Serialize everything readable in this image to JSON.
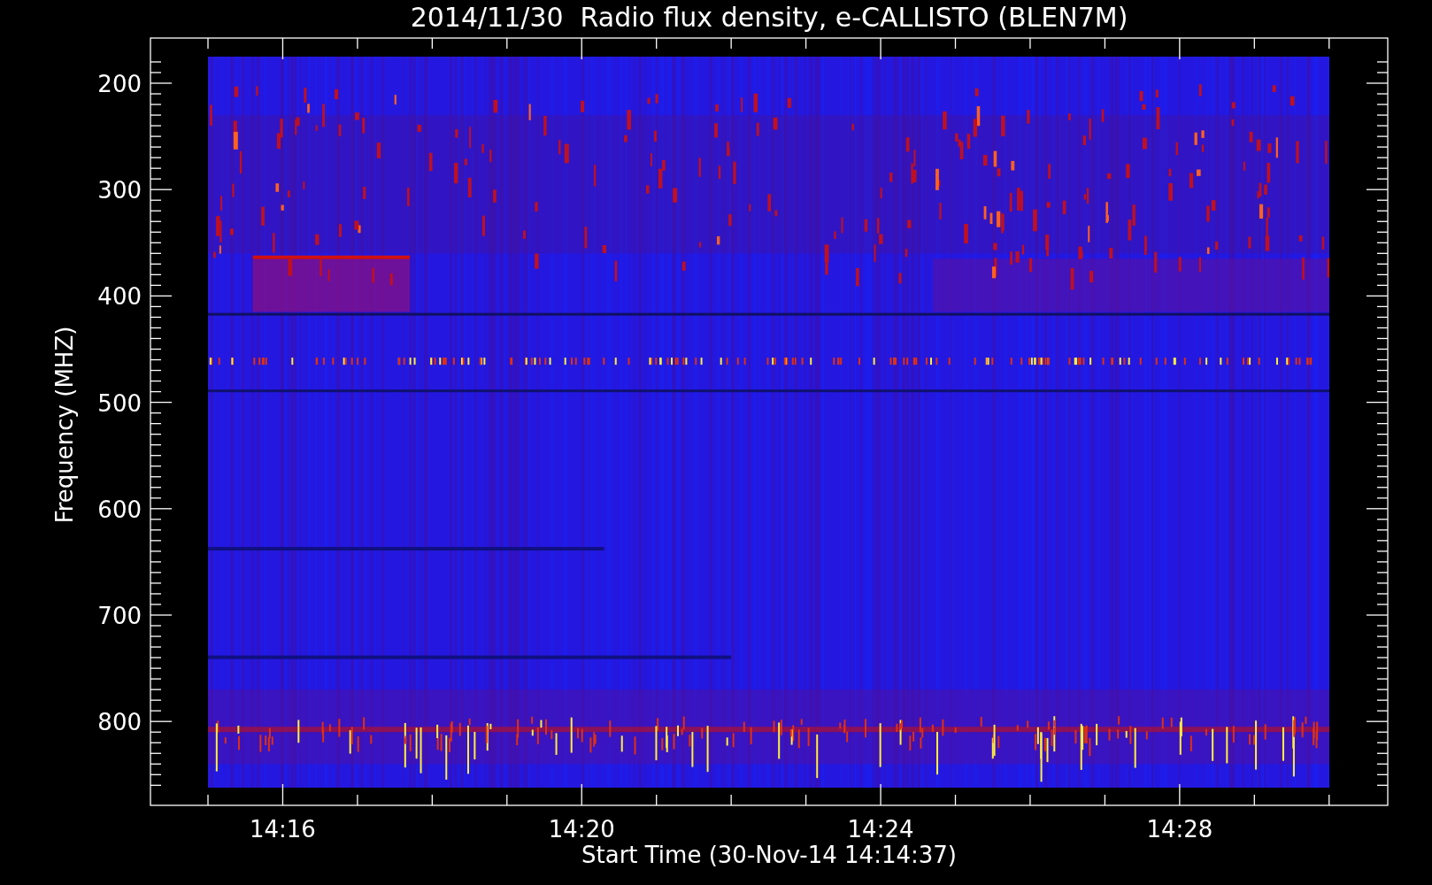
{
  "title": "2014/11/30  Radio flux density, e-CALLISTO (BLEN7M)",
  "plot": {
    "ylabel": "Frequency (MHZ)",
    "xlabel": "Start Time (30-Nov-14 14:14:37)",
    "yticks": [
      "200",
      "300",
      "400",
      "500",
      "600",
      "700",
      "800"
    ],
    "xticks": [
      "14:16",
      "14:20",
      "14:24",
      "14:28"
    ]
  }
}
